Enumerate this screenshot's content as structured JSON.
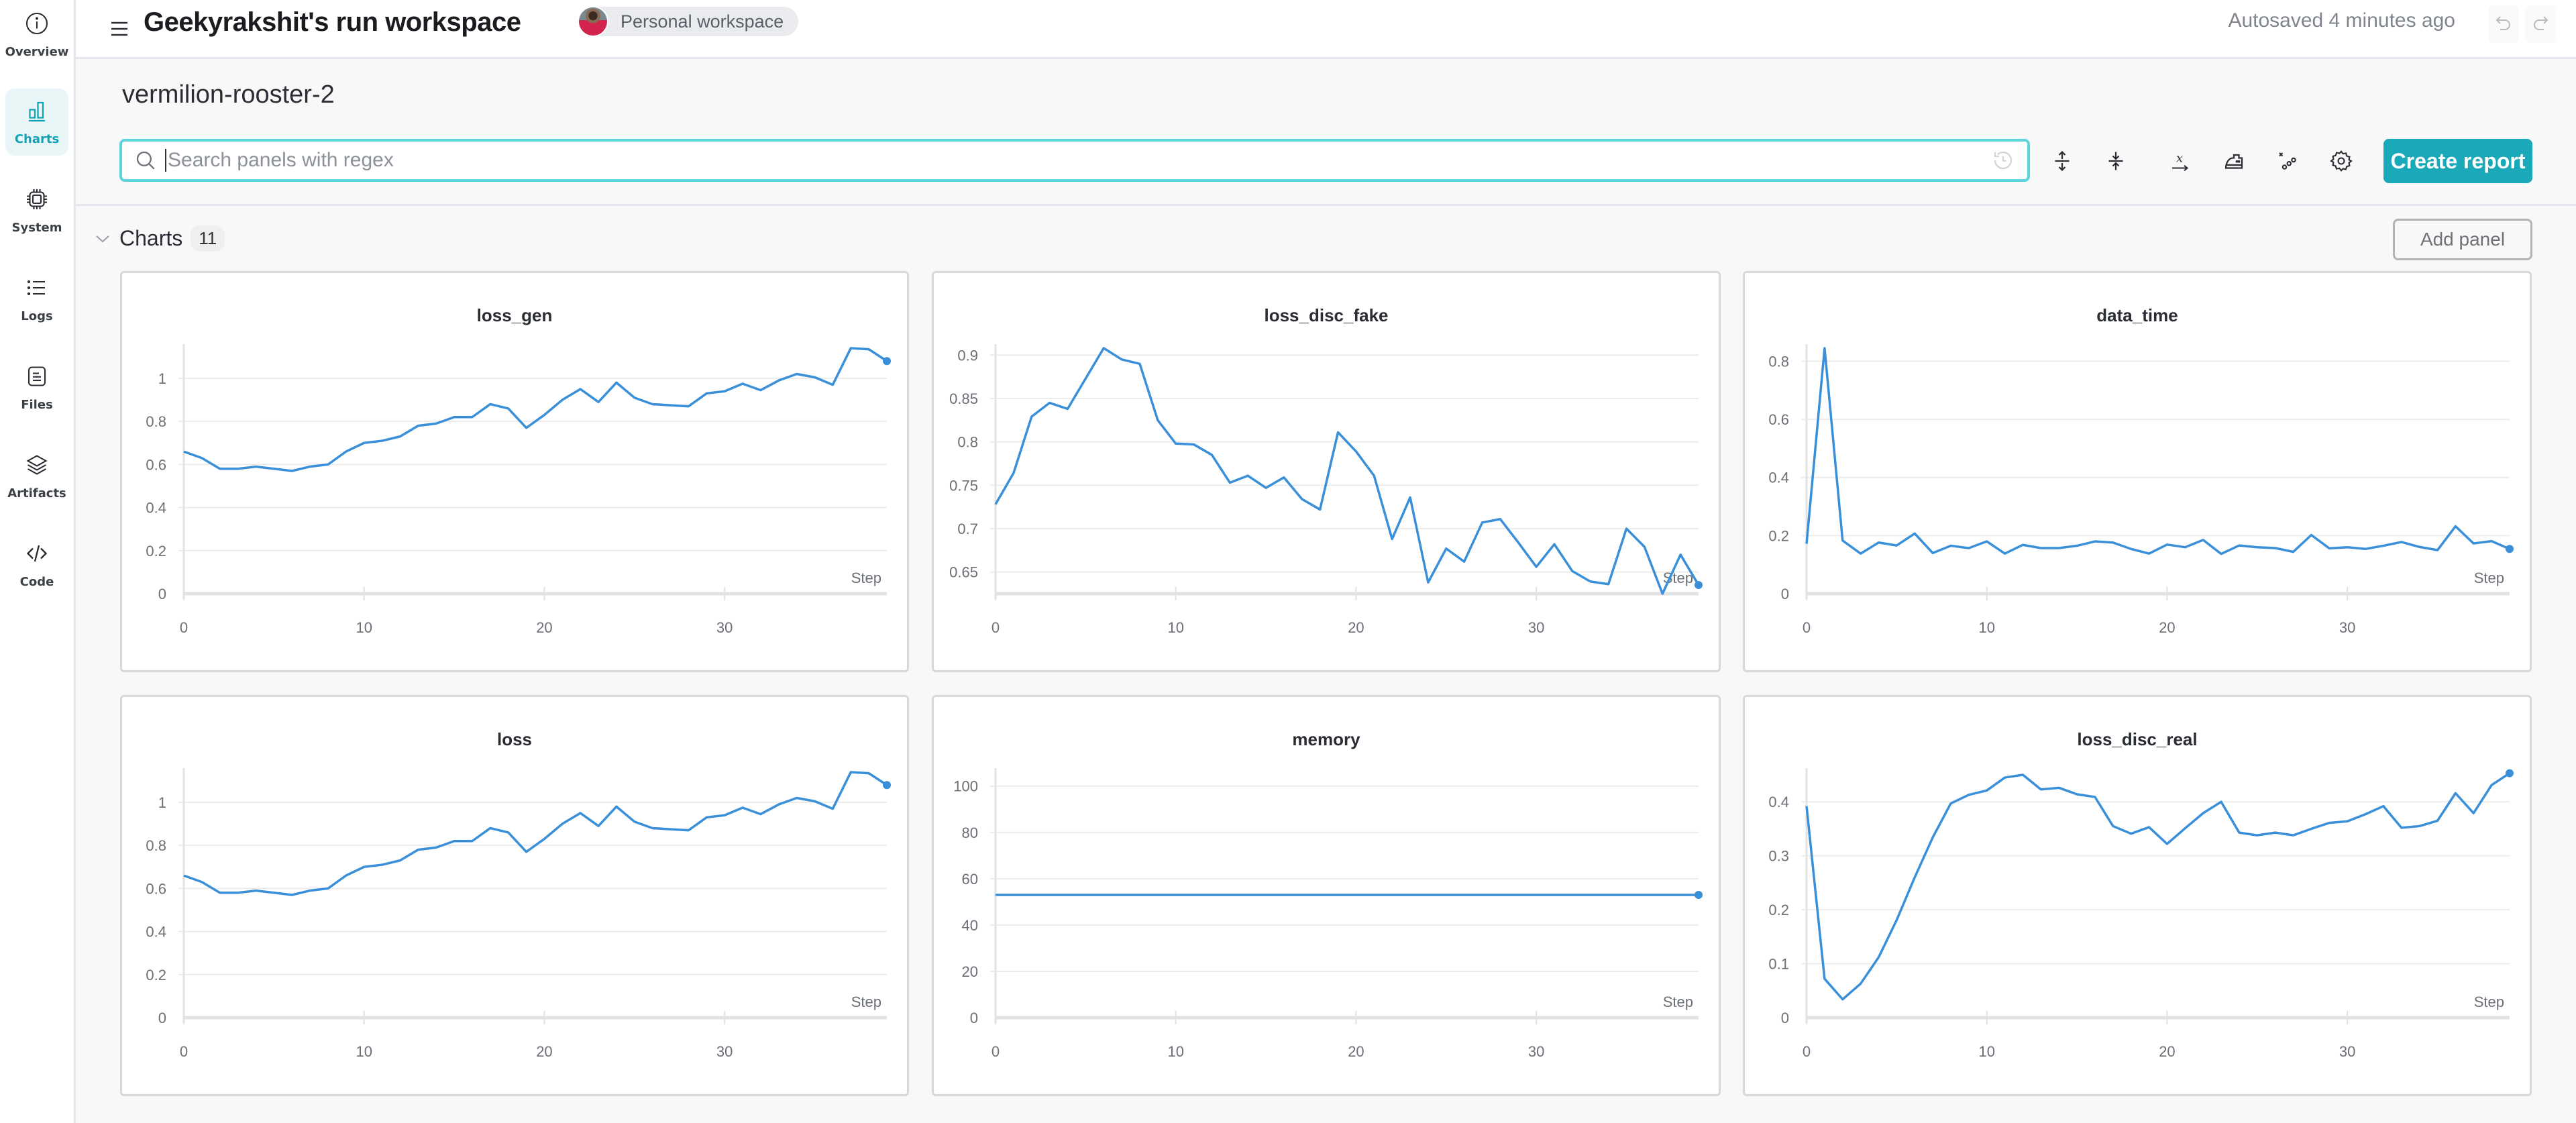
{
  "sidebar": {
    "items": [
      {
        "label": "Overview",
        "icon": "info-icon",
        "active": false
      },
      {
        "label": "Charts",
        "icon": "bar-chart-icon",
        "active": true
      },
      {
        "label": "System",
        "icon": "chip-icon",
        "active": false
      },
      {
        "label": "Logs",
        "icon": "list-icon",
        "active": false
      },
      {
        "label": "Files",
        "icon": "file-icon",
        "active": false
      },
      {
        "label": "Artifacts",
        "icon": "layers-icon",
        "active": false
      },
      {
        "label": "Code",
        "icon": "code-icon",
        "active": false
      }
    ]
  },
  "header": {
    "title": "Geekyrakshit's run workspace",
    "workspace_label": "Personal workspace",
    "autosaved": "Autosaved 4 minutes ago"
  },
  "run_name": "vermilion-rooster-2",
  "search": {
    "placeholder": "Search panels with regex",
    "value": ""
  },
  "toolbar": {
    "icons": [
      "expand-vertical-icon",
      "collapse-vertical-icon",
      "x-axis-icon",
      "smoothing-iron-icon",
      "outliers-icon",
      "settings-gear-icon"
    ],
    "create_report_label": "Create report"
  },
  "section": {
    "title": "Charts",
    "count": "11",
    "add_panel_label": "Add panel"
  },
  "colors": {
    "accent": "#19a9b8",
    "line": "#3a8fd9",
    "search_border": "#5dd3dc"
  },
  "chart_data": [
    {
      "type": "line",
      "title": "loss_gen",
      "xlabel": "Step",
      "x_ticks": [
        0,
        10,
        20,
        30
      ],
      "y_ticks": [
        0,
        0.2,
        0.4,
        0.6,
        0.8,
        1
      ],
      "ylim": [
        0,
        1.14
      ],
      "xlim": [
        0,
        39
      ],
      "series": [
        {
          "name": "loss_gen",
          "values": [
            0.66,
            0.63,
            0.58,
            0.58,
            0.59,
            0.58,
            0.57,
            0.59,
            0.6,
            0.66,
            0.7,
            0.71,
            0.73,
            0.78,
            0.79,
            0.82,
            0.82,
            0.88,
            0.86,
            0.77,
            0.83,
            0.9,
            0.95,
            0.89,
            0.98,
            0.91,
            0.88,
            0.875,
            0.87,
            0.93,
            0.94,
            0.975,
            0.945,
            0.99,
            1.02,
            1.005,
            0.97,
            1.14,
            1.135,
            1.08
          ]
        }
      ]
    },
    {
      "type": "line",
      "title": "loss_disc_fake",
      "xlabel": "Step",
      "x_ticks": [
        0,
        10,
        20,
        30
      ],
      "y_ticks": [
        0.65,
        0.7,
        0.75,
        0.8,
        0.85,
        0.9
      ],
      "ylim": [
        0.625,
        0.908
      ],
      "xlim": [
        0,
        39
      ],
      "series": [
        {
          "name": "loss_disc_fake",
          "values": [
            0.728,
            0.764,
            0.829,
            0.845,
            0.838,
            0.873,
            0.908,
            0.895,
            0.89,
            0.825,
            0.798,
            0.797,
            0.785,
            0.753,
            0.761,
            0.747,
            0.759,
            0.734,
            0.722,
            0.811,
            0.789,
            0.761,
            0.688,
            0.736,
            0.638,
            0.677,
            0.662,
            0.707,
            0.711,
            0.684,
            0.656,
            0.682,
            0.651,
            0.639,
            0.636,
            0.7,
            0.679,
            0.625,
            0.67,
            0.635
          ]
        }
      ]
    },
    {
      "type": "line",
      "title": "data_time",
      "xlabel": "Step",
      "x_ticks": [
        0,
        10,
        20,
        30
      ],
      "y_ticks": [
        0,
        0.2,
        0.4,
        0.6,
        0.8
      ],
      "ylim": [
        0,
        0.845
      ],
      "xlim": [
        0,
        39
      ],
      "series": [
        {
          "name": "data_time",
          "values": [
            0.172,
            0.845,
            0.183,
            0.138,
            0.176,
            0.166,
            0.207,
            0.14,
            0.165,
            0.157,
            0.18,
            0.138,
            0.168,
            0.157,
            0.157,
            0.165,
            0.18,
            0.176,
            0.154,
            0.138,
            0.169,
            0.16,
            0.185,
            0.137,
            0.166,
            0.16,
            0.157,
            0.144,
            0.202,
            0.156,
            0.16,
            0.154,
            0.165,
            0.178,
            0.161,
            0.15,
            0.232,
            0.173,
            0.181,
            0.154
          ]
        }
      ]
    },
    {
      "type": "line",
      "title": "loss",
      "xlabel": "Step",
      "x_ticks": [
        0,
        10,
        20,
        30
      ],
      "y_ticks": [
        0,
        0.2,
        0.4,
        0.6,
        0.8,
        1
      ],
      "ylim": [
        0,
        1.14
      ],
      "xlim": [
        0,
        39
      ],
      "series": [
        {
          "name": "loss",
          "values": [
            0.66,
            0.63,
            0.58,
            0.58,
            0.59,
            0.58,
            0.57,
            0.59,
            0.6,
            0.66,
            0.7,
            0.71,
            0.73,
            0.78,
            0.79,
            0.82,
            0.82,
            0.88,
            0.86,
            0.77,
            0.83,
            0.9,
            0.95,
            0.89,
            0.98,
            0.91,
            0.88,
            0.875,
            0.87,
            0.93,
            0.94,
            0.975,
            0.945,
            0.99,
            1.02,
            1.005,
            0.97,
            1.14,
            1.135,
            1.08
          ]
        }
      ]
    },
    {
      "type": "line",
      "title": "memory",
      "xlabel": "Step",
      "x_ticks": [
        0,
        10,
        20,
        30
      ],
      "y_ticks": [
        0,
        20,
        40,
        60,
        80,
        100
      ],
      "ylim": [
        0,
        106
      ],
      "xlim": [
        0,
        39
      ],
      "series": [
        {
          "name": "memory",
          "values": [
            53,
            53,
            53,
            53,
            53,
            53,
            53,
            53,
            53,
            53,
            53,
            53,
            53,
            53,
            53,
            53,
            53,
            53,
            53,
            53,
            53,
            53,
            53,
            53,
            53,
            53,
            53,
            53,
            53,
            53,
            53,
            53,
            53,
            53,
            53,
            53,
            53,
            53,
            53,
            53
          ]
        }
      ]
    },
    {
      "type": "line",
      "title": "loss_disc_real",
      "xlabel": "Step",
      "x_ticks": [
        0,
        10,
        20,
        30
      ],
      "y_ticks": [
        0,
        0.1,
        0.2,
        0.3,
        0.4
      ],
      "ylim": [
        0,
        0.455
      ],
      "xlim": [
        0,
        39
      ],
      "series": [
        {
          "name": "loss_disc_real",
          "values": [
            0.392,
            0.072,
            0.034,
            0.063,
            0.112,
            0.181,
            0.26,
            0.334,
            0.397,
            0.413,
            0.421,
            0.445,
            0.45,
            0.423,
            0.426,
            0.414,
            0.409,
            0.355,
            0.341,
            0.353,
            0.322,
            0.351,
            0.379,
            0.4,
            0.343,
            0.338,
            0.343,
            0.338,
            0.35,
            0.361,
            0.364,
            0.377,
            0.392,
            0.352,
            0.355,
            0.365,
            0.416,
            0.379,
            0.431,
            0.453
          ]
        }
      ]
    }
  ]
}
